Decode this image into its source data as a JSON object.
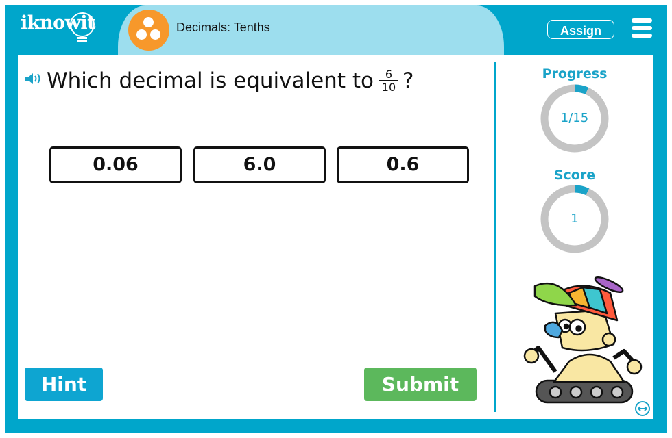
{
  "header": {
    "logo_text": "iknowit",
    "topic_icon": "three-dots-icon",
    "topic_title": "Decimals: Tenths",
    "assign_label": "Assign",
    "menu_icon": "hamburger-menu-icon"
  },
  "question": {
    "speaker_icon": "speaker-icon",
    "text": "Which decimal is equivalent to",
    "fraction": {
      "numerator": "6",
      "denominator": "10"
    },
    "suffix": "?"
  },
  "choices": [
    "0.06",
    "6.0",
    "0.6"
  ],
  "buttons": {
    "hint": "Hint",
    "submit": "Submit"
  },
  "sidebar": {
    "progress": {
      "label": "Progress",
      "value": "1/15",
      "fraction": 0.0667
    },
    "score": {
      "label": "Score",
      "value": "1",
      "fraction": 0.07
    },
    "mascot": "robot-mascot",
    "swap_icon": "swap-arrows-icon"
  },
  "colors": {
    "brand": "#00a6cb",
    "tab": "#9ddeee",
    "topic": "#f7982b",
    "hint": "#0ea5d1",
    "submit": "#5cb85c",
    "ring_track": "#c4c4c4"
  }
}
